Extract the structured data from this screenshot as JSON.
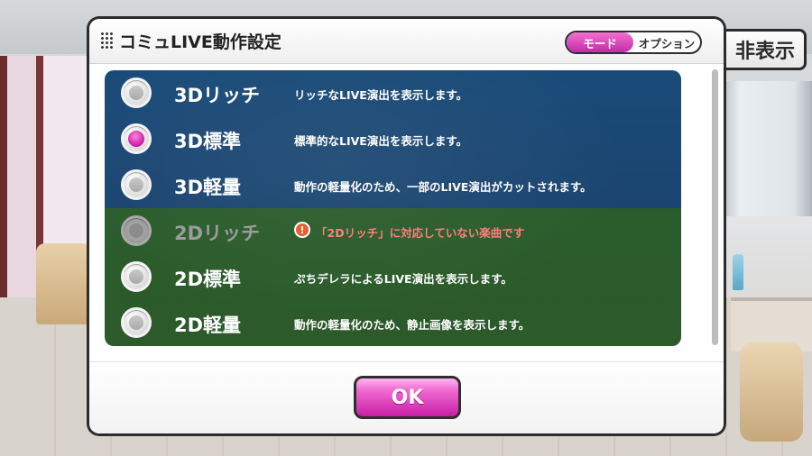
{
  "background": {
    "hide_button_label": "非表示"
  },
  "dialog": {
    "title": "コミュLIVE動作設定",
    "tabs": [
      {
        "label": "モード",
        "active": true
      },
      {
        "label": "オプション",
        "active": false
      }
    ],
    "options": [
      {
        "label": "3Dリッチ",
        "description": "リッチなLIVE演出を表示します。",
        "selected": false,
        "disabled": false
      },
      {
        "label": "3D標準",
        "description": "標準的なLIVE演出を表示します。",
        "selected": true,
        "disabled": false
      },
      {
        "label": "3D軽量",
        "description": "動作の軽量化のため、一部のLIVE演出がカットされます。",
        "selected": false,
        "disabled": false
      },
      {
        "label": "2Dリッチ",
        "description": "「2Dリッチ」に対応していない楽曲です",
        "selected": false,
        "disabled": true,
        "warning": true,
        "warning_icon": "!"
      },
      {
        "label": "2D標準",
        "description": "ぷちデレラによるLIVE演出を表示します。",
        "selected": false,
        "disabled": false
      },
      {
        "label": "2D軽量",
        "description": "動作の軽量化のため、静止画像を表示します。",
        "selected": false,
        "disabled": false
      }
    ],
    "ok_label": "OK"
  },
  "colors": {
    "accent_pink": "#e040c0",
    "panel_blue": "#1a4b78",
    "panel_green": "#2c5a2a",
    "warning_red": "#ff7a7a"
  }
}
